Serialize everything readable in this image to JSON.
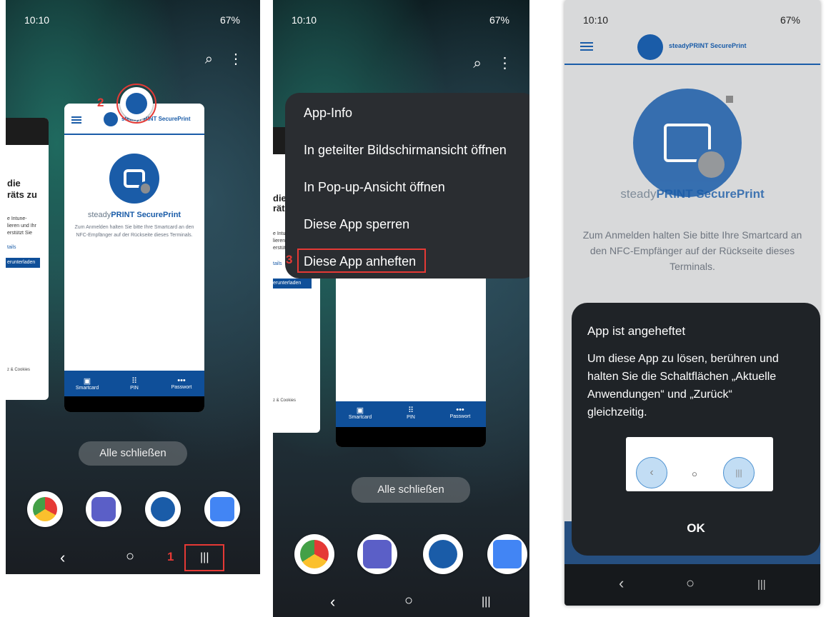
{
  "status": {
    "time": "10:10",
    "right": "67%"
  },
  "card": {
    "header_brand": "steadyPRINT SecurePrint",
    "brand_light": "steady",
    "brand_bold": "PRINT",
    "brand_tail": " SecurePrint",
    "description": "Zum Anmelden halten Sie bitte Ihre Smartcard an den NFC-Empfänger auf der Rückseite dieses Terminals.",
    "bottom_smartcard": "Smartcard",
    "bottom_pin": "PIN",
    "bottom_passwort": "Passwort"
  },
  "left_card": {
    "line1": "die",
    "line2": "räts zu",
    "small1": "e Intune-",
    "small2": "lieren und Ihr",
    "small3": "erstützt Sie",
    "link": "tails",
    "button": "erunterladen",
    "footer": "z & Cookies"
  },
  "close_all": "Alle schließen",
  "steps": {
    "one": "1",
    "two": "2",
    "three": "3"
  },
  "menu": {
    "items": [
      "App-Info",
      "In geteilter Bildschirmansicht öffnen",
      "In Pop-up-Ansicht öffnen",
      "Diese App sperren",
      "Diese App anheften"
    ]
  },
  "dialog": {
    "title": "App ist angeheftet",
    "body": "Um diese App zu lösen, berühren und halten Sie die Schaltflächen „Aktuelle Anwendungen“ und „Zurück“ gleichzeitig.",
    "ok": "OK"
  },
  "p3_header_brand": "steadyPRINT SecurePrint",
  "nav": {
    "back": "‹",
    "home": "○",
    "recents": "|||"
  },
  "colors": {
    "accent": "#1a5ca8",
    "highlight": "#e53935"
  },
  "dock_apps": [
    "chrome-icon",
    "teams-icon",
    "secureprint-icon",
    "google-news-icon"
  ]
}
